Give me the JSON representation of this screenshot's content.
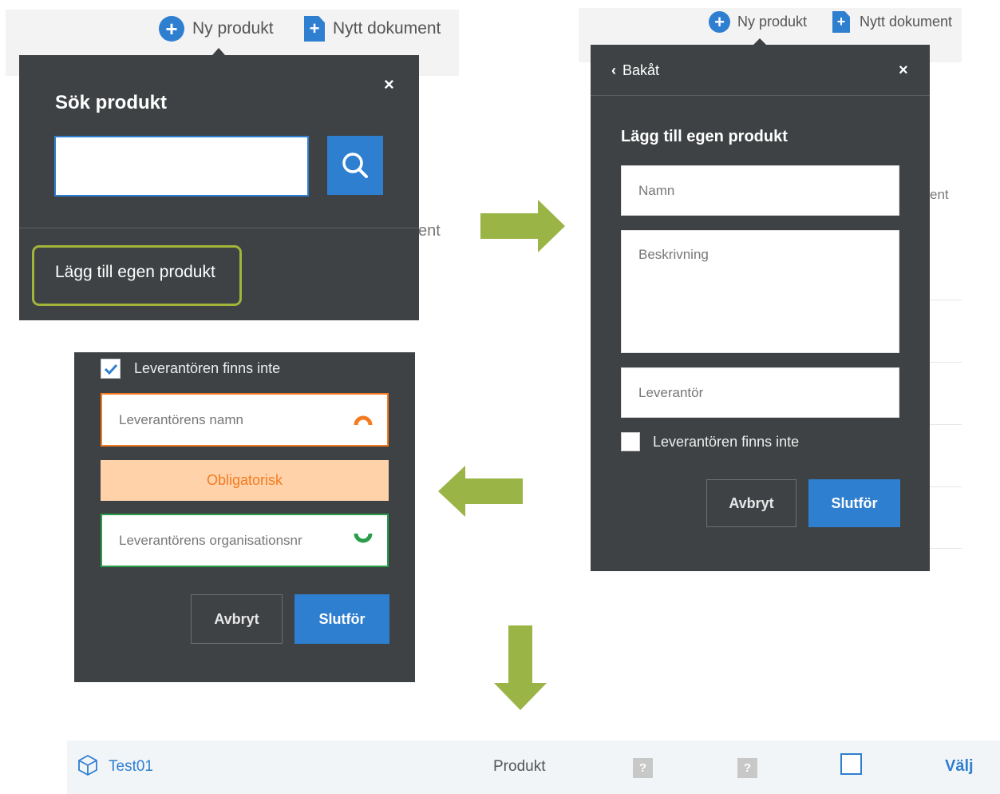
{
  "toolbar": {
    "new_product": "Ny produkt",
    "new_document": "Nytt dokument"
  },
  "search_panel": {
    "title": "Sök produkt",
    "search_value": "",
    "add_own": "Lägg till egen produkt",
    "behind_text": "ent"
  },
  "add_panel": {
    "back": "Bakåt",
    "title": "Lägg till egen produkt",
    "name_placeholder": "Namn",
    "description_placeholder": "Beskrivning",
    "supplier_placeholder": "Leverantör",
    "supplier_missing": "Leverantören finns inte",
    "supplier_missing_checked": false,
    "cancel": "Avbryt",
    "finish": "Slutför",
    "behind_text": "ent"
  },
  "supplier_panel": {
    "supplier_missing": "Leverantören finns inte",
    "supplier_missing_checked": true,
    "supplier_name_placeholder": "Leverantörens namn",
    "required": "Obligatorisk",
    "org_number_placeholder": "Leverantörens organisationsnr",
    "cancel": "Avbryt",
    "finish": "Slutför"
  },
  "result_row": {
    "name": "Test01",
    "type": "Produkt",
    "unknown_1": "?",
    "unknown_2": "?",
    "select": "Välj"
  },
  "colors": {
    "panel": "#3e4244",
    "accent_blue": "#2f7fd0",
    "highlight_green": "#a2b43a",
    "arrow_green": "#9bb446",
    "error_orange": "#f47b20",
    "error_bg": "#ffd2aa",
    "valid_green": "#2a9d4a"
  }
}
